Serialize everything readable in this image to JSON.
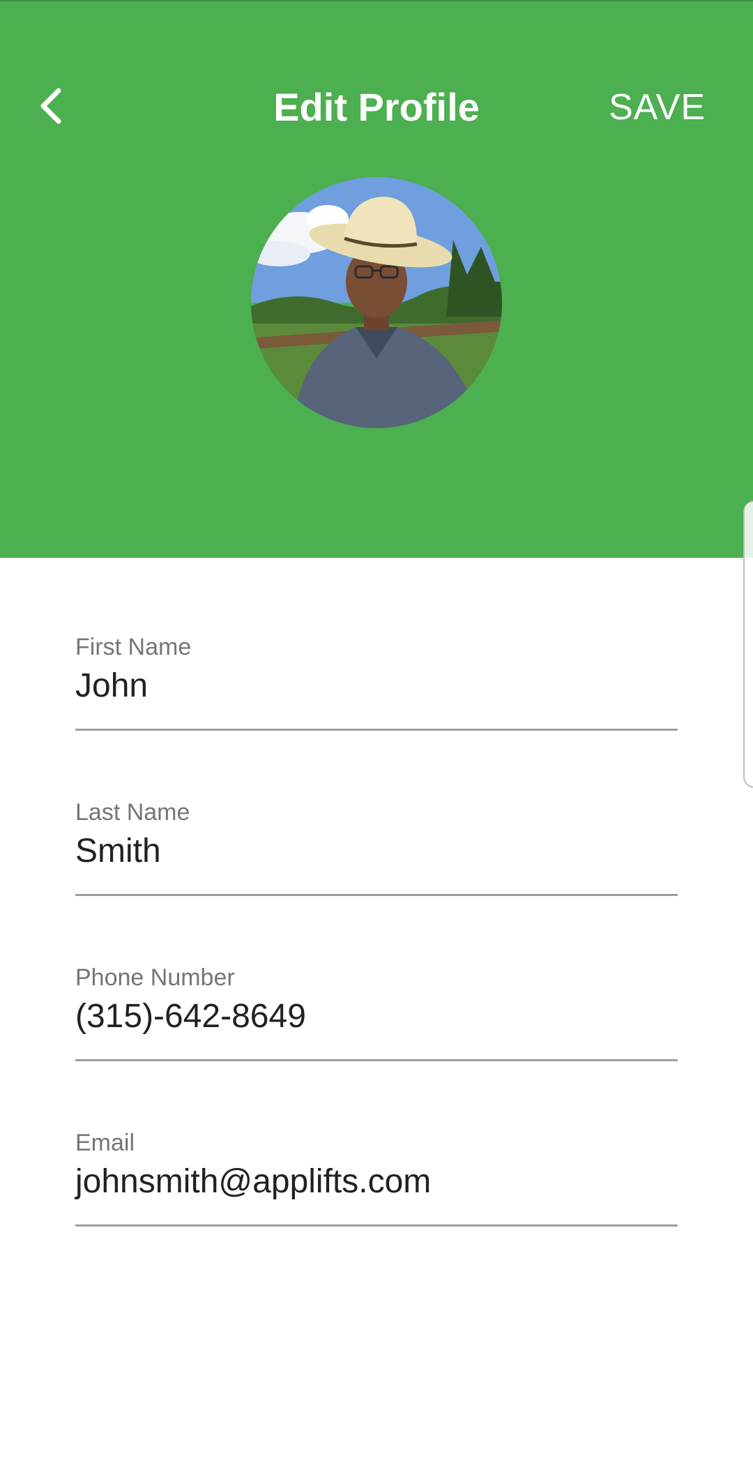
{
  "header": {
    "title": "Edit Profile",
    "save_label": "SAVE",
    "back_icon": "chevron-left-icon",
    "background_color": "#4caf50"
  },
  "avatar": {
    "description_icon": "profile-photo"
  },
  "form": {
    "fields": [
      {
        "label": "First Name",
        "value": "John"
      },
      {
        "label": "Last Name",
        "value": "Smith"
      },
      {
        "label": "Phone Number",
        "value": "(315)-642-8649"
      },
      {
        "label": "Email",
        "value": "johnsmith@applifts.com"
      }
    ]
  }
}
